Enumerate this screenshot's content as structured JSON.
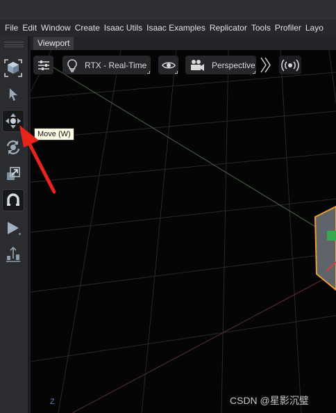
{
  "menu": [
    "File",
    "Edit",
    "Window",
    "Create",
    "Isaac Utils",
    "Isaac Examples",
    "Replicator",
    "Tools",
    "Profiler",
    "Layo"
  ],
  "toolbar": {
    "tools": [
      {
        "name": "select-mode-icon",
        "active": false
      },
      {
        "name": "select-pointer-icon",
        "active": false
      },
      {
        "name": "move-icon",
        "active": true
      },
      {
        "name": "rotate-icon",
        "active": false
      },
      {
        "name": "scale-icon",
        "active": false
      },
      {
        "name": "snap-magnet-icon",
        "active": true
      },
      {
        "name": "play-icon",
        "active": false
      },
      {
        "name": "physics-tools-icon",
        "active": false
      }
    ],
    "tooltip": "Move (W)"
  },
  "viewport": {
    "tab_label": "Viewport",
    "render_mode": "RTX - Real-Time",
    "camera": "Perspective",
    "axis_label": "Z"
  },
  "watermark": "CSDN @星影沉璧",
  "colors": {
    "background": "#050505",
    "panel": "#2b2c30",
    "menubar": "#27282c",
    "selection_outline": "#f0a030",
    "annotation_arrow": "#e8241c",
    "grid": "#2c2c2c"
  }
}
